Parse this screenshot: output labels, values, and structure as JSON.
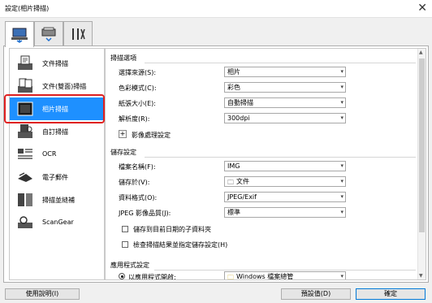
{
  "window": {
    "title": "設定(相片掃描)"
  },
  "tabs": [
    {
      "name": "scan-from-computer-tab",
      "icon": "computer-icon"
    },
    {
      "name": "scan-from-panel-tab",
      "icon": "scanner-icon"
    },
    {
      "name": "general-settings-tab",
      "icon": "tools-icon"
    }
  ],
  "sidebar": {
    "items": [
      {
        "label": "文件掃描",
        "icon": "document-scan-icon"
      },
      {
        "label": "文件(雙面)掃描",
        "icon": "duplex-scan-icon"
      },
      {
        "label": "相片掃描",
        "icon": "photo-scan-icon",
        "selected": true
      },
      {
        "label": "自訂掃描",
        "icon": "custom-scan-icon"
      },
      {
        "label": "OCR",
        "icon": "ocr-icon"
      },
      {
        "label": "電子郵件",
        "icon": "email-icon"
      },
      {
        "label": "掃描並縫補",
        "icon": "stitch-icon"
      },
      {
        "label": "ScanGear",
        "icon": "scangear-icon"
      }
    ]
  },
  "scan_options": {
    "title": "掃描選項",
    "rows": [
      {
        "label": "選擇來源(S):",
        "value": "相片"
      },
      {
        "label": "色彩模式(C):",
        "value": "彩色"
      },
      {
        "label": "紙張大小(E):",
        "value": "自動掃描"
      },
      {
        "label": "解析度(R):",
        "value": "300dpi"
      }
    ],
    "image_processing": "影像處理設定"
  },
  "save_settings": {
    "title": "儲存設定",
    "file_name_label": "檔案名稱(F):",
    "file_name_value": "IMG",
    "save_in_label": "儲存於(V):",
    "save_in_value": "文件",
    "data_format_label": "資料格式(O):",
    "data_format_value": "JPEG/Exif",
    "jpeg_quality_label": "JPEG 影像品質(J):",
    "jpeg_quality_value": "標準",
    "checkbox1": "儲存到目前日期的子資料夾",
    "checkbox2": "檢查掃描結果並指定儲存設定(H)"
  },
  "app_settings": {
    "title": "應用程式設定",
    "radio_label": "以應用程式開啟:",
    "app_value": "Windows 檔案總管"
  },
  "footer": {
    "help": "使用說明(I)",
    "defaults": "預設值(D)",
    "ok": "確定"
  },
  "colors": {
    "selected": "#1e90ff",
    "highlight_outline": "#e02020"
  }
}
